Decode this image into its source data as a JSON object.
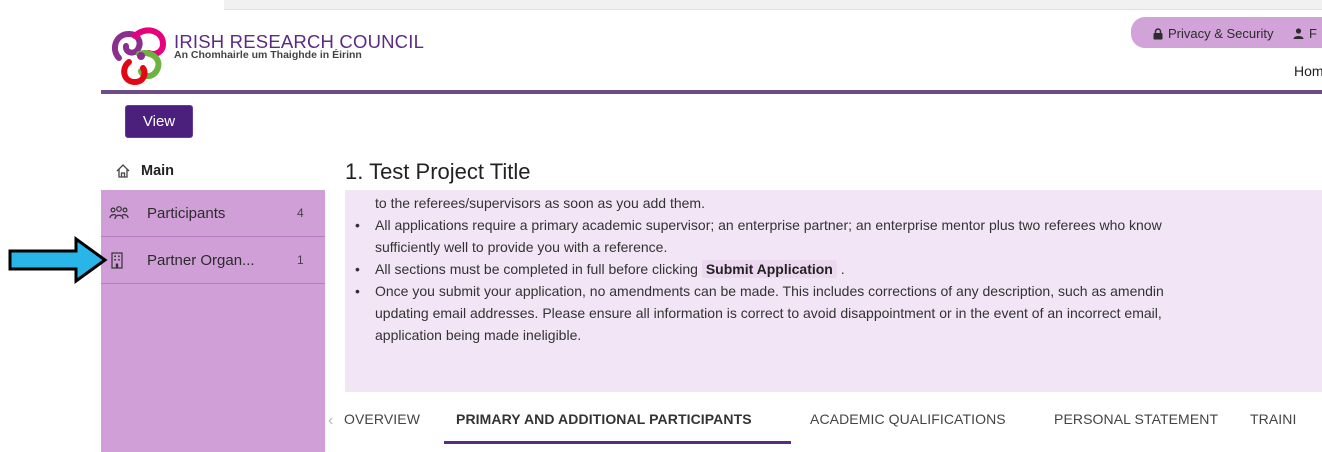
{
  "header": {
    "brand_name": "IRISH RESEARCH COUNCIL",
    "brand_sub": "An Chomhairle um Thaighde in Éirinn",
    "privacy_label": "Privacy & Security",
    "profile_label_fragment": "F",
    "home_link_fragment": "Hom"
  },
  "toolbar": {
    "view_label": "View"
  },
  "sidebar": {
    "main_label": "Main",
    "items": [
      {
        "label": "Participants",
        "count": "4",
        "icon": "participants-icon"
      },
      {
        "label": "Partner Organ...",
        "count": "1",
        "icon": "building-icon"
      }
    ]
  },
  "page": {
    "title": "1. Test Project Title"
  },
  "notice": {
    "lines": [
      "to the referees/supervisors as soon as you add them.",
      "All applications require a primary academic supervisor; an enterprise partner; an enterprise mentor plus two referees who know",
      "sufficiently well to provide you with a reference.",
      "All sections must be completed in full before clicking",
      "Submit Application",
      ".",
      "Once you submit your application, no amendments can be made. This includes corrections of any description, such as amendin",
      "updating email addresses. Please ensure all information is correct to avoid disappointment or in the event of an incorrect email,",
      "application being made ineligible."
    ]
  },
  "tabs": [
    {
      "label": "OVERVIEW"
    },
    {
      "label": "PRIMARY AND ADDITIONAL PARTICIPANTS",
      "active": true
    },
    {
      "label": "ACADEMIC QUALIFICATIONS"
    },
    {
      "label": "PERSONAL STATEMENT"
    },
    {
      "label": "TRAINI"
    }
  ],
  "colors": {
    "brand_purple": "#4b1f7c",
    "sidebar_bg": "#d09fd7",
    "notice_bg": "#f2e5f5",
    "arrow_fill": "#29b5e8"
  }
}
